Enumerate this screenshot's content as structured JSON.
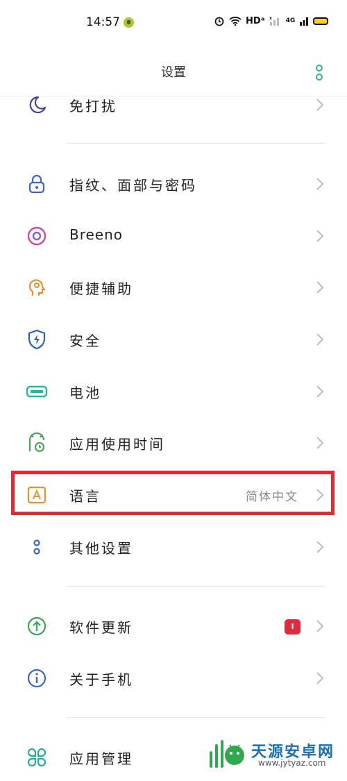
{
  "status_bar": {
    "time": "14:57",
    "indicators": "HDᵃ",
    "network": "4G"
  },
  "header": {
    "title": "设置"
  },
  "rows": {
    "dnd": {
      "label": "免打扰",
      "icon": "moon-icon"
    },
    "fingerprint": {
      "label": "指纹、面部与密码",
      "icon": "lock-icon"
    },
    "breeno": {
      "label": "Breeno",
      "icon": "breeno-icon"
    },
    "accessibility": {
      "label": "便捷辅助",
      "icon": "accessibility-icon"
    },
    "security": {
      "label": "安全",
      "icon": "shield-icon"
    },
    "battery": {
      "label": "电池",
      "icon": "battery-icon"
    },
    "screentime": {
      "label": "应用使用时间",
      "icon": "screen-time-icon"
    },
    "language": {
      "label": "语言",
      "value": "简体中文",
      "icon": "language-icon"
    },
    "other": {
      "label": "其他设置",
      "icon": "other-settings-icon"
    },
    "update": {
      "label": "软件更新",
      "badge": "I",
      "icon": "update-icon"
    },
    "about": {
      "label": "关于手机",
      "icon": "info-icon"
    },
    "apps": {
      "label": "应用管理",
      "icon": "apps-icon"
    }
  },
  "watermark": {
    "name": "天源安卓网",
    "url": "www.jytyaz.com"
  },
  "colors": {
    "highlight": "#e32a2f",
    "accent": "#2fb980",
    "badge": "#e02a3e"
  }
}
